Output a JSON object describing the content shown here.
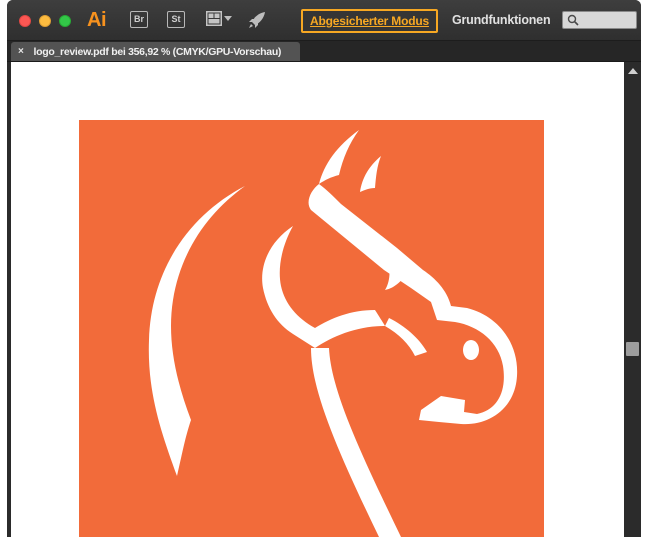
{
  "titlebar": {
    "app_logo": "Ai",
    "bridge_label": "Br",
    "stock_label": "St",
    "mode_button_label": "Abgesicherter Modus",
    "workspace_label": "Grundfunktionen",
    "search_placeholder": ""
  },
  "tabs": [
    {
      "label": "logo_review.pdf bei 356,92 % (CMYK/GPU-Vorschau)",
      "close": "×"
    }
  ],
  "icons": {
    "window_close": "close-icon",
    "window_minimize": "minimize-icon",
    "window_maximize": "maximize-icon",
    "layout": "layout-grid-icon",
    "rocket": "rocket-icon",
    "search": "search-icon",
    "scroll_up": "chevron-up-icon"
  },
  "colors": {
    "accent": "#f7a823",
    "app_logo": "#f7921e",
    "artwork_background": "#f26b3a",
    "artwork_foreground": "#ffffff"
  }
}
